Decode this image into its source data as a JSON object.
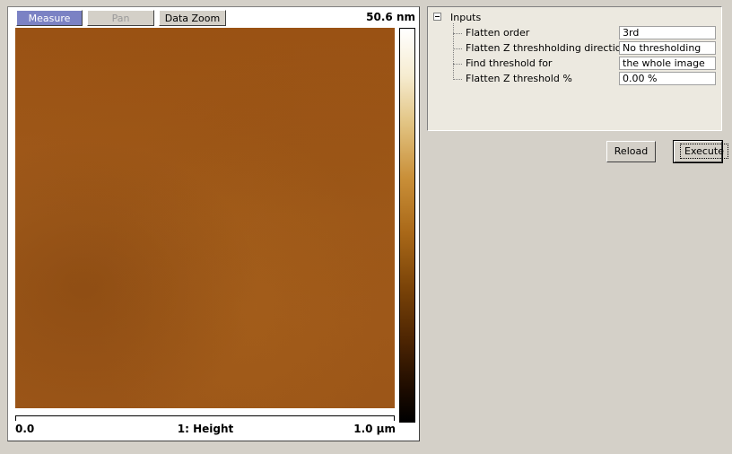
{
  "viewer": {
    "toolbar": {
      "measure_label": "Measure",
      "pan_label": "Pan",
      "zoom_label": "Data Zoom"
    },
    "z_max_label": "50.6 nm",
    "axis": {
      "min_label": "0.0",
      "channel_label": "1: Height",
      "max_label": "1.0 µm"
    }
  },
  "parameters": {
    "root_label": "Inputs",
    "rows": [
      {
        "label": "Flatten order",
        "value": "3rd"
      },
      {
        "label": "Flatten Z threshholding direction",
        "value": "No thresholding"
      },
      {
        "label": "Find threshold for",
        "value": "the whole image"
      },
      {
        "label": "Flatten Z threshold %",
        "value": "0.00 %"
      }
    ]
  },
  "actions": {
    "reload_label": "Reload",
    "execute_label": "Execute"
  },
  "colors": {
    "active_tool": "#7b82c4",
    "window_bg": "#d4d0c8",
    "image_base": "#9e5818"
  }
}
